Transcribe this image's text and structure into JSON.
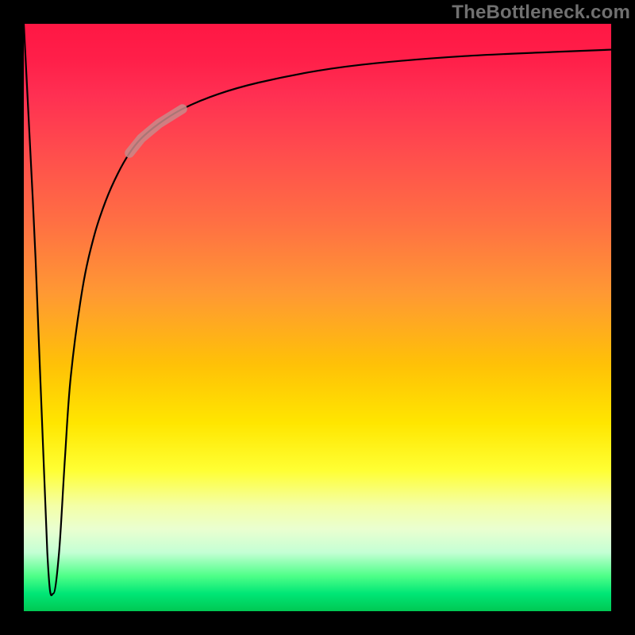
{
  "watermark": "TheBottleneck.com",
  "chart_data": {
    "type": "line",
    "title": "",
    "xlabel": "",
    "ylabel": "",
    "xlim": [
      0,
      100
    ],
    "ylim": [
      0,
      100
    ],
    "grid": false,
    "legend": false,
    "series": [
      {
        "name": "bottleneck-curve",
        "x": [
          0,
          2,
          4,
          5,
          6,
          7,
          8,
          10,
          12,
          14,
          16,
          18,
          20,
          23,
          27,
          33,
          40,
          50,
          60,
          75,
          90,
          100
        ],
        "y": [
          100,
          60,
          10,
          3,
          10,
          26,
          40,
          55,
          64,
          70,
          74.5,
          78,
          80.5,
          83,
          85.5,
          88,
          90,
          92,
          93.3,
          94.5,
          95.2,
          95.6
        ]
      }
    ],
    "highlight_segment": {
      "x_start": 18,
      "x_end": 27,
      "color": "#c98a8a"
    },
    "background_gradient": {
      "direction": "vertical",
      "stops": [
        {
          "pos": 0.0,
          "color": "#ff1744"
        },
        {
          "pos": 0.22,
          "color": "#ff4d4d"
        },
        {
          "pos": 0.46,
          "color": "#ff9933"
        },
        {
          "pos": 0.68,
          "color": "#ffe600"
        },
        {
          "pos": 0.82,
          "color": "#f4ffa6"
        },
        {
          "pos": 0.94,
          "color": "#4eff88"
        },
        {
          "pos": 1.0,
          "color": "#00c853"
        }
      ]
    }
  }
}
